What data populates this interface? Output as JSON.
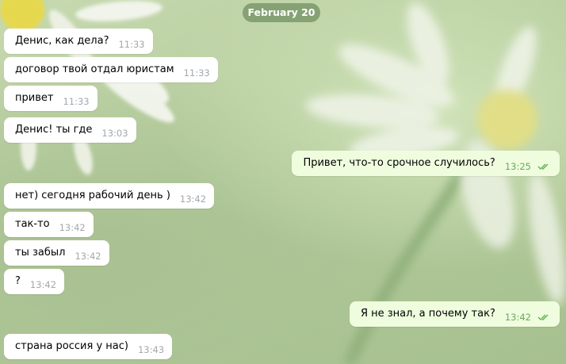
{
  "date_separator": "February 20",
  "messages": [
    {
      "text": "Денис, как дела?",
      "time": "11:33"
    },
    {
      "text": "договор твой отдал юристам",
      "time": "11:33"
    },
    {
      "text": "привет",
      "time": "11:33"
    },
    {
      "text": "Денис! ты где",
      "time": "13:03"
    },
    {
      "text": "Привет, что-то срочное случилось?",
      "time": "13:25"
    },
    {
      "text": "нет) сегодня рабочий день )",
      "time": "13:42"
    },
    {
      "text": "так-то",
      "time": "13:42"
    },
    {
      "text": "ты забыл",
      "time": "13:42"
    },
    {
      "text": "?",
      "time": "13:42"
    },
    {
      "text": "Я не знал, а почему так?",
      "time": "13:42"
    },
    {
      "text": "страна россия у нас)",
      "time": "13:43"
    }
  ],
  "icons": {
    "read_status": "double-check-icon"
  },
  "colors": {
    "incoming_bubble": "#ffffff",
    "outgoing_bubble": "#effdde",
    "outgoing_time": "#68ab5f",
    "incoming_time": "#a3a8ad",
    "date_pill": "#799668"
  }
}
